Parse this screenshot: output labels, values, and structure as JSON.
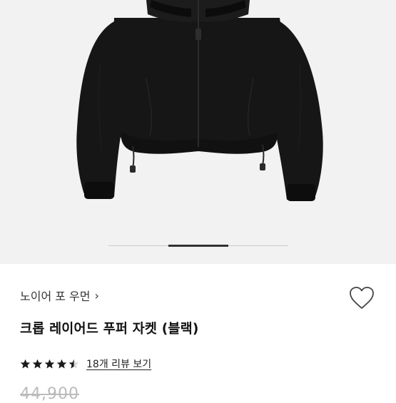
{
  "product": {
    "brand": "노이어 포 우먼",
    "title": "크롭 레이어드 푸퍼 자켓 (블랙)",
    "rating": 4.5,
    "reviews_label": "18개 리뷰 보기",
    "price": "44,900"
  },
  "gallery": {
    "image_icon": "black-cropped-puffer-jacket",
    "slide_count": 3,
    "active_slide": 2
  },
  "icons": {
    "brand_chevron": "chevron-right-icon",
    "wishlist": "heart-outline-icon"
  },
  "colors": {
    "hero_bg": "#f2f2f2",
    "jacket": "#141414",
    "star": "#1a1a1a"
  }
}
